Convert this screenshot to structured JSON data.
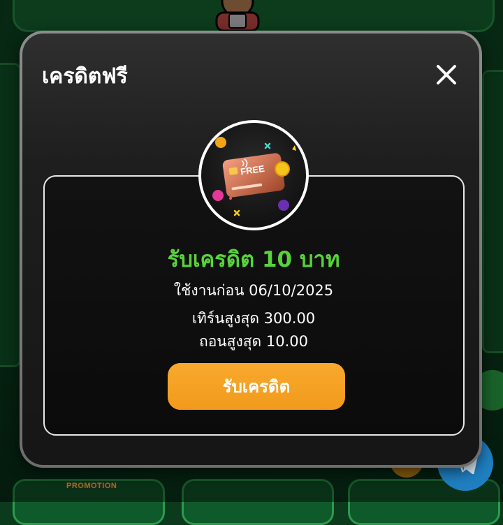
{
  "modal": {
    "title": "เครดิตฟรี",
    "close_icon": "close-icon",
    "badge_icon": "free-credit-card-icon",
    "badge_card_text": "FREE",
    "offer_title": "รับเครดิต 10 บาท",
    "use_before": "ใช้งานก่อน 06/10/2025",
    "max_turnover": "เทิร์นสูงสุด 300.00",
    "max_withdraw": "ถอนสูงสุด 10.00",
    "claim_button": "รับเครดิต"
  },
  "background": {
    "promo_badge": "PROMOTION",
    "telegram_icon": "telegram-icon"
  },
  "colors": {
    "accent_green": "#58d33a",
    "button_orange": "#f29a1b",
    "modal_bg": "#1e1e1e",
    "telegram_blue": "#1f7fc1"
  }
}
